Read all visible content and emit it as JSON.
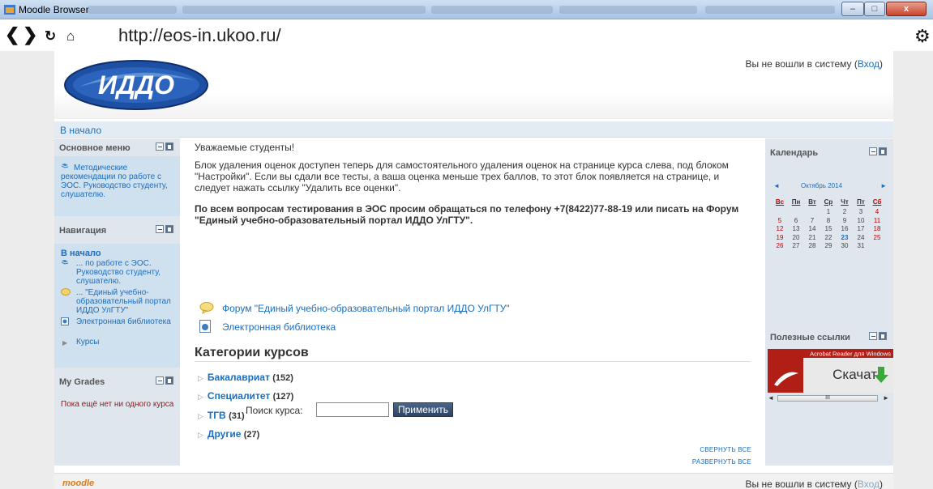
{
  "window": {
    "title": "Moodle Browser",
    "buttons": {
      "minimize": "–",
      "maximize": "□",
      "close": "x"
    }
  },
  "browser": {
    "back_glyph": "❮",
    "forward_glyph": "❯",
    "reload_glyph": "↻",
    "home_glyph": "⌂",
    "url": "http://eos-in.ukoo.ru/",
    "settings_glyph": "⚙"
  },
  "header": {
    "logo_text": "ИДДО",
    "login_text": "Вы не вошли в систему (",
    "login_link": "Вход",
    "login_close": ")"
  },
  "navbar": {
    "home": "В начало"
  },
  "left_blocks": {
    "main_menu": {
      "title": "Основное меню",
      "item": "Методические рекомендации по работе с ЭОС. Руководство студенту, слушателю."
    },
    "navigation": {
      "title": "Навигация",
      "home": "В начало",
      "items": [
        "... по работе с ЭОС. Руководство студенту, слушателю.",
        "... \"Единый учебно-образовательный портал ИДДО УлГТУ\"",
        "Электронная библиотека",
        "Курсы"
      ]
    },
    "grades": {
      "title": "My Grades",
      "text": "Пока ещё нет ни одного курса"
    }
  },
  "main": {
    "greeting": "Уважаемые студенты!",
    "notice": "Блок удаления оценок доступен теперь для самостоятельного удаления оценок на странице курса слева, под блоком \"Настройки\". Если вы сдали все тесты, а ваша оценка меньше трех баллов, то этот блок появляется на странице, и следует нажать ссылку \"Удалить все оценки\".",
    "contact": "По всем вопросам тестирования в ЭОС просим обращаться по телефону +7(8422)77-88-19 или писать на Форум \"Единый учебно-образовательный портал ИДДО УлГТУ\".",
    "resources": [
      "Форум \"Единый учебно-образовательный портал ИДДО УлГТУ\"",
      "Электронная библиотека"
    ],
    "categories_heading": "Категории курсов",
    "categories": [
      {
        "name": "Бакалавриат",
        "count": "(152)"
      },
      {
        "name": "Специалитет",
        "count": "(127)"
      },
      {
        "name": "ТГВ",
        "count": "(31)"
      },
      {
        "name": "Другие",
        "count": "(27)"
      }
    ],
    "collapse_all": "Свернуть все",
    "expand_all": "Развернуть все",
    "search_label": "Поиск курса:",
    "search_value": "",
    "search_button": "Применить"
  },
  "right_blocks": {
    "calendar": {
      "title": "Календарь",
      "month": "Октябрь 2014",
      "prev": "◄",
      "next": "►",
      "weekdays": [
        "Вс",
        "Пн",
        "Вт",
        "Ср",
        "Чт",
        "Пт",
        "Сб"
      ],
      "weeks": [
        [
          "",
          "",
          "",
          "1",
          "2",
          "3",
          "4"
        ],
        [
          "5",
          "6",
          "7",
          "8",
          "9",
          "10",
          "11"
        ],
        [
          "12",
          "13",
          "14",
          "15",
          "16",
          "17",
          "18"
        ],
        [
          "19",
          "20",
          "21",
          "22",
          "23",
          "24",
          "25"
        ],
        [
          "26",
          "27",
          "28",
          "29",
          "30",
          "31",
          ""
        ]
      ],
      "today": "23"
    },
    "links": {
      "title": "Полезные ссылки",
      "ad_caption": "Acrobat Reader для Windows",
      "ad_button": "Скачать",
      "scroll_left": "◄",
      "scroll_right": "►",
      "scroll_grip": "III"
    }
  },
  "footer": {
    "moodle": "moodle",
    "login_text": "Вы не вошли в систему (",
    "login_link": "Вход",
    "login_close": ")"
  },
  "colors": {
    "link": "#1a6ec0",
    "block_bg": "#dfe6ed",
    "logo_blue": "#1d4fa3",
    "button": "#2b4466"
  }
}
